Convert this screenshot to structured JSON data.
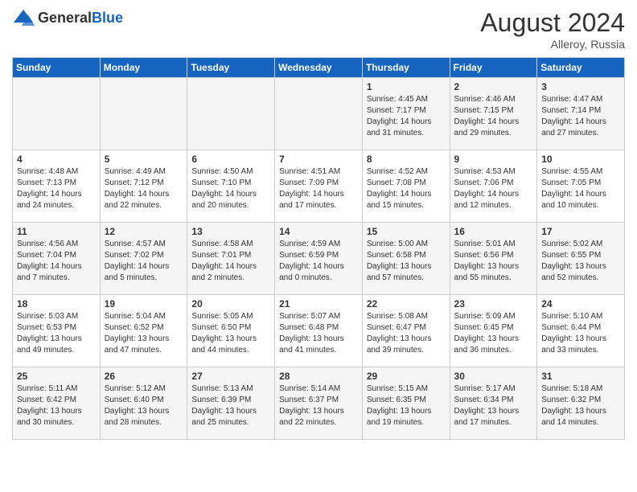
{
  "header": {
    "logo_general": "General",
    "logo_blue": "Blue",
    "month_year": "August 2024",
    "location": "Alleroy, Russia"
  },
  "days_of_week": [
    "Sunday",
    "Monday",
    "Tuesday",
    "Wednesday",
    "Thursday",
    "Friday",
    "Saturday"
  ],
  "weeks": [
    [
      {
        "day": "",
        "info": ""
      },
      {
        "day": "",
        "info": ""
      },
      {
        "day": "",
        "info": ""
      },
      {
        "day": "",
        "info": ""
      },
      {
        "day": "1",
        "info": "Sunrise: 4:45 AM\nSunset: 7:17 PM\nDaylight: 14 hours\nand 31 minutes."
      },
      {
        "day": "2",
        "info": "Sunrise: 4:46 AM\nSunset: 7:15 PM\nDaylight: 14 hours\nand 29 minutes."
      },
      {
        "day": "3",
        "info": "Sunrise: 4:47 AM\nSunset: 7:14 PM\nDaylight: 14 hours\nand 27 minutes."
      }
    ],
    [
      {
        "day": "4",
        "info": "Sunrise: 4:48 AM\nSunset: 7:13 PM\nDaylight: 14 hours\nand 24 minutes."
      },
      {
        "day": "5",
        "info": "Sunrise: 4:49 AM\nSunset: 7:12 PM\nDaylight: 14 hours\nand 22 minutes."
      },
      {
        "day": "6",
        "info": "Sunrise: 4:50 AM\nSunset: 7:10 PM\nDaylight: 14 hours\nand 20 minutes."
      },
      {
        "day": "7",
        "info": "Sunrise: 4:51 AM\nSunset: 7:09 PM\nDaylight: 14 hours\nand 17 minutes."
      },
      {
        "day": "8",
        "info": "Sunrise: 4:52 AM\nSunset: 7:08 PM\nDaylight: 14 hours\nand 15 minutes."
      },
      {
        "day": "9",
        "info": "Sunrise: 4:53 AM\nSunset: 7:06 PM\nDaylight: 14 hours\nand 12 minutes."
      },
      {
        "day": "10",
        "info": "Sunrise: 4:55 AM\nSunset: 7:05 PM\nDaylight: 14 hours\nand 10 minutes."
      }
    ],
    [
      {
        "day": "11",
        "info": "Sunrise: 4:56 AM\nSunset: 7:04 PM\nDaylight: 14 hours\nand 7 minutes."
      },
      {
        "day": "12",
        "info": "Sunrise: 4:57 AM\nSunset: 7:02 PM\nDaylight: 14 hours\nand 5 minutes."
      },
      {
        "day": "13",
        "info": "Sunrise: 4:58 AM\nSunset: 7:01 PM\nDaylight: 14 hours\nand 2 minutes."
      },
      {
        "day": "14",
        "info": "Sunrise: 4:59 AM\nSunset: 6:59 PM\nDaylight: 14 hours\nand 0 minutes."
      },
      {
        "day": "15",
        "info": "Sunrise: 5:00 AM\nSunset: 6:58 PM\nDaylight: 13 hours\nand 57 minutes."
      },
      {
        "day": "16",
        "info": "Sunrise: 5:01 AM\nSunset: 6:56 PM\nDaylight: 13 hours\nand 55 minutes."
      },
      {
        "day": "17",
        "info": "Sunrise: 5:02 AM\nSunset: 6:55 PM\nDaylight: 13 hours\nand 52 minutes."
      }
    ],
    [
      {
        "day": "18",
        "info": "Sunrise: 5:03 AM\nSunset: 6:53 PM\nDaylight: 13 hours\nand 49 minutes."
      },
      {
        "day": "19",
        "info": "Sunrise: 5:04 AM\nSunset: 6:52 PM\nDaylight: 13 hours\nand 47 minutes."
      },
      {
        "day": "20",
        "info": "Sunrise: 5:05 AM\nSunset: 6:50 PM\nDaylight: 13 hours\nand 44 minutes."
      },
      {
        "day": "21",
        "info": "Sunrise: 5:07 AM\nSunset: 6:48 PM\nDaylight: 13 hours\nand 41 minutes."
      },
      {
        "day": "22",
        "info": "Sunrise: 5:08 AM\nSunset: 6:47 PM\nDaylight: 13 hours\nand 39 minutes."
      },
      {
        "day": "23",
        "info": "Sunrise: 5:09 AM\nSunset: 6:45 PM\nDaylight: 13 hours\nand 36 minutes."
      },
      {
        "day": "24",
        "info": "Sunrise: 5:10 AM\nSunset: 6:44 PM\nDaylight: 13 hours\nand 33 minutes."
      }
    ],
    [
      {
        "day": "25",
        "info": "Sunrise: 5:11 AM\nSunset: 6:42 PM\nDaylight: 13 hours\nand 30 minutes."
      },
      {
        "day": "26",
        "info": "Sunrise: 5:12 AM\nSunset: 6:40 PM\nDaylight: 13 hours\nand 28 minutes."
      },
      {
        "day": "27",
        "info": "Sunrise: 5:13 AM\nSunset: 6:39 PM\nDaylight: 13 hours\nand 25 minutes."
      },
      {
        "day": "28",
        "info": "Sunrise: 5:14 AM\nSunset: 6:37 PM\nDaylight: 13 hours\nand 22 minutes."
      },
      {
        "day": "29",
        "info": "Sunrise: 5:15 AM\nSunset: 6:35 PM\nDaylight: 13 hours\nand 19 minutes."
      },
      {
        "day": "30",
        "info": "Sunrise: 5:17 AM\nSunset: 6:34 PM\nDaylight: 13 hours\nand 17 minutes."
      },
      {
        "day": "31",
        "info": "Sunrise: 5:18 AM\nSunset: 6:32 PM\nDaylight: 13 hours\nand 14 minutes."
      }
    ]
  ]
}
